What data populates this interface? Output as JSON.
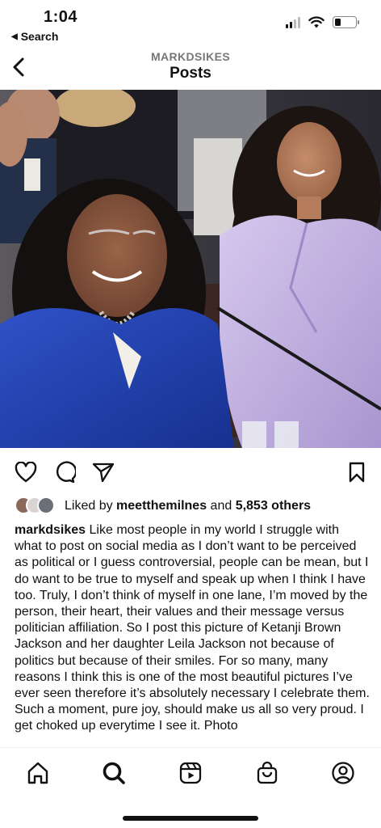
{
  "status_bar": {
    "time": "1:04",
    "back_app_label": "Search",
    "battery_level": 0.28,
    "signal_bars_on": 2,
    "signal_bars_total": 4
  },
  "header": {
    "account": "MARKDSIKES",
    "title": "Posts"
  },
  "post": {
    "image_alt": "Ketanji Brown Jackson and her daughter Leila Jackson smiling at a hearing",
    "likes": {
      "prefix": "Liked by ",
      "user": "meetthemilnes",
      "joiner": " and ",
      "others": "5,853 others"
    },
    "caption": {
      "username": "markdsikes",
      "text": "Like most people in my world I struggle with what to post on social media as I don’t want to be perceived as political or I guess controversial, people can be mean, but I do want to be true to myself and speak up when I think I have too. Truly, I don’t think of myself in one lane, I’m moved by the person, their heart, their values and their message versus politician affiliation. So I post this picture of Ketanji Brown Jackson and her daughter Leila Jackson not because of politics but because of their smiles. For so many, many reasons I think this is one of the most beautiful pictures I’ve ever seen therefore it’s absolutely necessary I celebrate them. Such a moment, pure joy, should make us all so very proud. I get choked up everytime I see it. Photo"
    }
  },
  "actions": {
    "like_icon": "heart-icon",
    "comment_icon": "comment-icon",
    "share_icon": "send-icon",
    "save_icon": "bookmark-icon"
  },
  "bottom_nav": {
    "items": [
      "home-icon",
      "search-icon",
      "reels-icon",
      "shop-icon",
      "profile-icon"
    ]
  },
  "colors": {
    "text": "#111111",
    "muted": "#777777",
    "blazer_blue": "#1f3fae",
    "lavender": "#c9b8e6"
  }
}
